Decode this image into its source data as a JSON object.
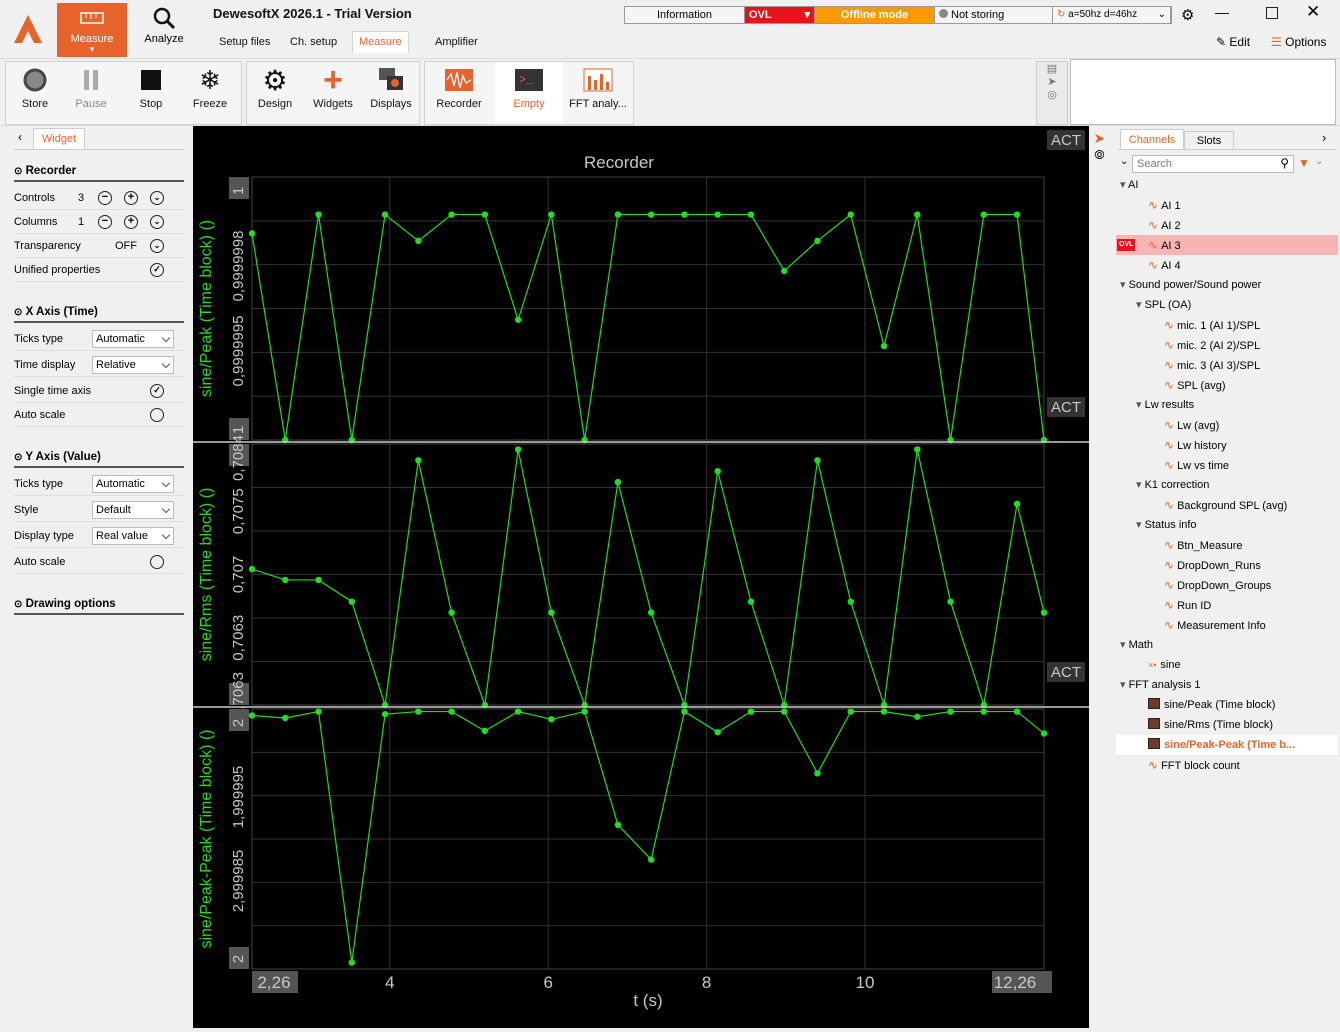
{
  "app": {
    "title": "DewesoftX 2026.1 - Trial Version",
    "measure_label": "Measure",
    "analyze_label": "Analyze"
  },
  "subtabs": [
    "Setup files",
    "Ch. setup",
    "Measure",
    "Amplifier"
  ],
  "status": {
    "information": "Information",
    "ovl": "OVL",
    "mode": "Offline mode",
    "storing": "Not storing",
    "filter": "a=50hz d=46hz"
  },
  "window_actions": {
    "edit": "Edit",
    "options": "Options"
  },
  "toolbar": {
    "store": "Store",
    "pause": "Pause",
    "stop": "Stop",
    "freeze": "Freeze",
    "design": "Design",
    "widgets": "Widgets",
    "displays": "Displays",
    "recorder": "Recorder",
    "empty": "Empty",
    "fft": "FFT analy..."
  },
  "left": {
    "tab": "Widget",
    "recorder_section": "Recorder",
    "controls_label": "Controls",
    "controls_value": "3",
    "columns_label": "Columns",
    "columns_value": "1",
    "transparency_label": "Transparency",
    "transparency_value": "OFF",
    "unified_label": "Unified properties",
    "xaxis_section": "X Axis (Time)",
    "x_ticks_label": "Ticks type",
    "x_ticks_value": "Automatic",
    "time_display_label": "Time display",
    "time_display_value": "Relative",
    "single_time_label": "Single time axis",
    "x_auto_label": "Auto scale",
    "yaxis_section": "Y Axis (Value)",
    "y_ticks_label": "Ticks type",
    "y_ticks_value": "Automatic",
    "style_label": "Style",
    "style_value": "Default",
    "display_type_label": "Display type",
    "display_type_value": "Real value",
    "y_auto_label": "Auto scale",
    "drawing_section": "Drawing options"
  },
  "chart_data": {
    "type": "line",
    "title": "Recorder",
    "xlabel": "t (s)",
    "xlim": [
      2.26,
      12.26
    ],
    "x_ticks": [
      "2,26",
      "4",
      "6",
      "8",
      "10",
      "12,26"
    ],
    "act_label": "ACT",
    "x": [
      2.26,
      2.68,
      3.1,
      3.52,
      3.94,
      4.36,
      4.78,
      5.2,
      5.62,
      6.04,
      6.46,
      6.88,
      7.3,
      7.72,
      8.14,
      8.56,
      8.98,
      9.4,
      9.82,
      10.24,
      10.66,
      11.08,
      11.5,
      11.92,
      12.26
    ],
    "panels": [
      {
        "name": "sine/Peak (Time block) ()",
        "ylim": [
          0.9999994,
          1.0000001
        ],
        "y_ticks": [
          "1",
          "0,9999998",
          "0,9999995",
          "1"
        ],
        "values": [
          0.99999995,
          0.9999994,
          1,
          0.9999994,
          1,
          0.99999993,
          1,
          1,
          0.99999972,
          1,
          0.9999994,
          1,
          1,
          1,
          1,
          1,
          0.99999985,
          0.99999993,
          1,
          0.99999965,
          1,
          0.9999994,
          1,
          1,
          0.9999994
        ]
      },
      {
        "name": "sine/Rms (Time block) ()",
        "ylim": [
          0.70605,
          0.70845
        ],
        "y_ticks": [
          "0,7084",
          "0,7075",
          "0,707",
          "0,7063",
          "0,7063"
        ],
        "values": [
          0.7073,
          0.7072,
          0.7072,
          0.707,
          0.70605,
          0.7083,
          0.7069,
          0.70605,
          0.7084,
          0.7069,
          0.70605,
          0.7081,
          0.7069,
          0.70605,
          0.7082,
          0.707,
          0.70605,
          0.7083,
          0.707,
          0.70605,
          0.7084,
          0.707,
          0.70605,
          0.7079,
          0.7069
        ]
      },
      {
        "name": "sine/Peak-Peak (Time block) ()",
        "ylim": [
          1.99998,
          2.0000002
        ],
        "y_ticks": [
          "2",
          "1,999995",
          "2,999985",
          "2"
        ],
        "values": [
          1.9999997,
          1.9999995,
          2,
          1.9999805,
          1.9999998,
          2,
          2,
          1.9999985,
          2,
          1.9999994,
          2,
          1.9999912,
          1.9999885,
          2,
          1.9999984,
          2,
          2,
          1.9999952,
          2,
          2,
          1.9999996,
          2,
          2,
          2,
          1.9999983
        ]
      }
    ]
  },
  "right": {
    "tab_channels": "Channels",
    "tab_slots": "Slots",
    "search_placeholder": "Search",
    "tree": [
      {
        "label": "AI",
        "level": 0,
        "kind": "group"
      },
      {
        "label": "AI 1",
        "level": 1,
        "kind": "wave"
      },
      {
        "label": "AI 2",
        "level": 1,
        "kind": "wave"
      },
      {
        "label": "AI 3",
        "level": 1,
        "kind": "wave",
        "ovl": "OVL"
      },
      {
        "label": "AI 4",
        "level": 1,
        "kind": "wave"
      },
      {
        "label": "Sound power/Sound power",
        "level": 0,
        "kind": "group"
      },
      {
        "label": "SPL (OA)",
        "level": 1,
        "kind": "group"
      },
      {
        "label": "mic. 1 (AI 1)/SPL",
        "level": 2,
        "kind": "wave"
      },
      {
        "label": "mic. 2 (AI 2)/SPL",
        "level": 2,
        "kind": "wave"
      },
      {
        "label": "mic. 3 (AI 3)/SPL",
        "level": 2,
        "kind": "wave"
      },
      {
        "label": "SPL (avg)",
        "level": 2,
        "kind": "wave"
      },
      {
        "label": "Lw results",
        "level": 1,
        "kind": "group"
      },
      {
        "label": "Lw (avg)",
        "level": 2,
        "kind": "wave"
      },
      {
        "label": "Lw history",
        "level": 2,
        "kind": "wave"
      },
      {
        "label": "Lw vs time",
        "level": 2,
        "kind": "wave"
      },
      {
        "label": "K1 correction",
        "level": 1,
        "kind": "group"
      },
      {
        "label": "Background SPL (avg)",
        "level": 2,
        "kind": "wave"
      },
      {
        "label": "Status info",
        "level": 1,
        "kind": "group"
      },
      {
        "label": "Btn_Measure",
        "level": 2,
        "kind": "wave"
      },
      {
        "label": "DropDown_Runs",
        "level": 2,
        "kind": "wave"
      },
      {
        "label": "DropDown_Groups",
        "level": 2,
        "kind": "wave"
      },
      {
        "label": "Run ID",
        "level": 2,
        "kind": "wave"
      },
      {
        "label": "Measurement Info",
        "level": 2,
        "kind": "wave"
      },
      {
        "label": "Math",
        "level": 0,
        "kind": "group"
      },
      {
        "label": "sine",
        "level": 1,
        "kind": "math"
      },
      {
        "label": "FFT analysis 1",
        "level": 0,
        "kind": "group"
      },
      {
        "label": "sine/Peak (Time block)",
        "level": 1,
        "kind": "fft"
      },
      {
        "label": "sine/Rms (Time block)",
        "level": 1,
        "kind": "fft"
      },
      {
        "label": "sine/Peak-Peak (Time b...",
        "level": 1,
        "kind": "fft",
        "selected": true
      },
      {
        "label": "FFT block count",
        "level": 1,
        "kind": "wave"
      }
    ]
  }
}
